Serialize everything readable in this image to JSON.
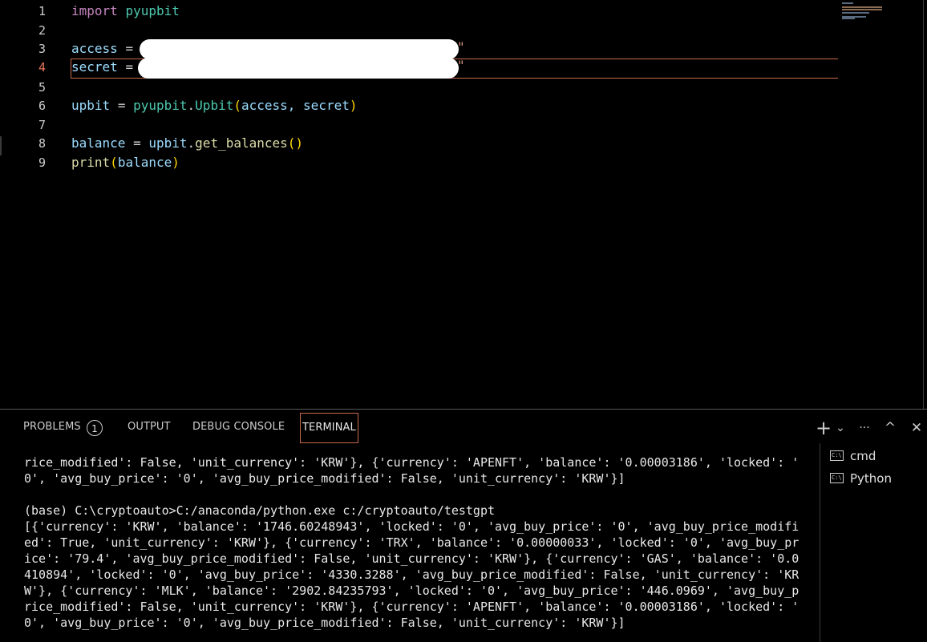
{
  "editor": {
    "line_numbers": [
      "1",
      "2",
      "3",
      "4",
      "5",
      "6",
      "7",
      "8",
      "9"
    ],
    "active_line": "4",
    "line1": {
      "kw": "import",
      "mod": "pyupbit"
    },
    "line3": {
      "var": "access",
      "op": "=",
      "tail": "\""
    },
    "line4": {
      "var": "secret",
      "op": "=",
      "tail": "\""
    },
    "line6": {
      "var": "upbit",
      "op": "=",
      "ns": "pyupbit",
      "dot": ".",
      "fn": "Upbit",
      "open": "(",
      "args": "access, secret",
      "close": ")"
    },
    "line8": {
      "var": "balance",
      "op": "=",
      "obj": "upbit",
      "dot": ".",
      "fn": "get_balances",
      "parens": "()"
    },
    "line9": {
      "fn": "print",
      "open": "(",
      "arg": "balance",
      "close": ")"
    }
  },
  "panel": {
    "tabs": [
      {
        "label": "PROBLEMS",
        "active": false
      },
      {
        "label": "OUTPUT",
        "active": false
      },
      {
        "label": "DEBUG CONSOLE",
        "active": false
      },
      {
        "label": "TERMINAL",
        "active": true
      }
    ],
    "problems_count": "1",
    "actions": {
      "new_terminal": "+",
      "dropdown": "⌄",
      "more": "···",
      "maximize": "^",
      "close": "✕"
    },
    "terminal_output": "rice_modified': False, 'unit_currency': 'KRW'}, {'currency': 'APENFT', 'balance': '0.00003186', 'locked': '\n0', 'avg_buy_price': '0', 'avg_buy_price_modified': False, 'unit_currency': 'KRW'}]\n\n(base) C:\\cryptoauto>C:/anaconda/python.exe c:/cryptoauto/testgpt\n[{'currency': 'KRW', 'balance': '1746.60248943', 'locked': '0', 'avg_buy_price': '0', 'avg_buy_price_modifi\ned': True, 'unit_currency': 'KRW'}, {'currency': 'TRX', 'balance': '0.00000033', 'locked': '0', 'avg_buy_pr\nice': '79.4', 'avg_buy_price_modified': False, 'unit_currency': 'KRW'}, {'currency': 'GAS', 'balance': '0.0\n410894', 'locked': '0', 'avg_buy_price': '4330.3288', 'avg_buy_price_modified': False, 'unit_currency': 'KR\nW'}, {'currency': 'MLK', 'balance': '2902.84235793', 'locked': '0', 'avg_buy_price': '446.0969', 'avg_buy_p\nrice_modified': False, 'unit_currency': 'KRW'}, {'currency': 'APENFT', 'balance': '0.00003186', 'locked': '\n0', 'avg_buy_price': '0', 'avg_buy_price_modified': False, 'unit_currency': 'KRW'}]",
    "terminals": [
      {
        "label": "cmd",
        "icon": "C:\\",
        "selected": false
      },
      {
        "label": "Python",
        "icon": "C:\\",
        "selected": true
      }
    ]
  }
}
